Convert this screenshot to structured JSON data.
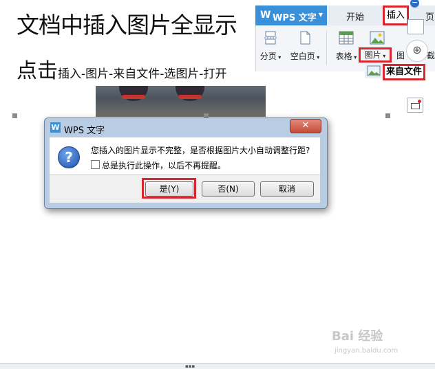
{
  "document": {
    "title": "文档中插入图片全显示",
    "instruction_big": "点击",
    "instruction_small": "插入-图片-来自文件-选图片-打开"
  },
  "ribbon": {
    "app_name": "WPS 文字",
    "app_logo": "W",
    "tabs": [
      "开始",
      "插入",
      "页"
    ],
    "buttons": {
      "page_break": "分页",
      "blank_page": "空白页",
      "table": "表格",
      "picture": "图片",
      "picture_partial": "图",
      "screenshot_partial": "截"
    },
    "dropdown_item": "来自文件"
  },
  "dialog": {
    "title": "WPS 文字",
    "logo": "W",
    "close_symbol": "✕",
    "message": "您插入的图片显示不完整，是否根据图片大小自动调整行距?",
    "checkbox_label": "总是执行此操作，以后不再提醒。",
    "checkbox_checked": false,
    "buttons": {
      "yes": "是(Y)",
      "no": "否(N)",
      "cancel": "取消"
    }
  },
  "watermark": {
    "text": "Bai 经验",
    "sub": "jingyan.baidu.com"
  },
  "icons": [
    "question-icon",
    "table-icon",
    "picture-icon",
    "page-break-icon",
    "blank-page-icon",
    "zoom-icon"
  ],
  "colors": {
    "highlight": "#d7262d",
    "wps_blue": "#3a8fd9",
    "dialog_frame": "#b8cde3"
  }
}
